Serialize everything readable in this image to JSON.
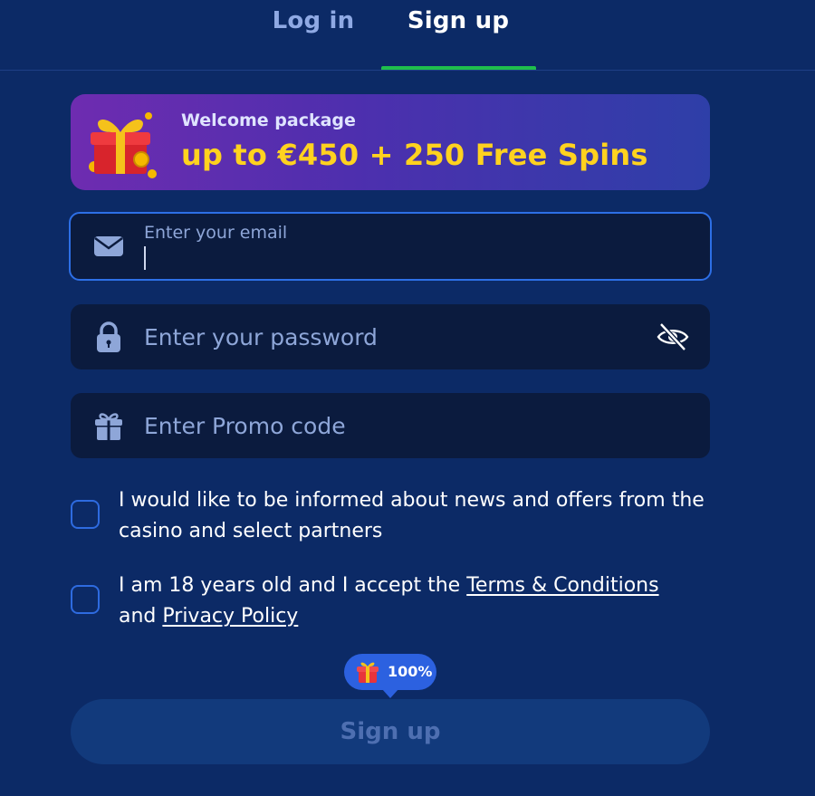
{
  "tabs": {
    "login": "Log in",
    "signup": "Sign up"
  },
  "banner": {
    "subtitle": "Welcome package",
    "offer": "up to €450 + 250 Free Spins",
    "icon": "gift-box-icon"
  },
  "email": {
    "label": "Enter your email",
    "value": "",
    "icon": "envelope-icon"
  },
  "password": {
    "placeholder": "Enter your password",
    "icon": "lock-icon",
    "toggle_icon": "eye-slash-icon"
  },
  "promo": {
    "placeholder": "Enter Promo code",
    "icon": "gift-icon"
  },
  "consents": {
    "news": {
      "text": "I would like to be informed about news and offers from the casino and select partners",
      "checked": false
    },
    "terms": {
      "prefix": "I am 18 years old and I accept the",
      "terms_link": "Terms & Conditions",
      "connector": "and",
      "privacy_link": "Privacy Policy",
      "checked": false
    }
  },
  "bonus_badge": {
    "value": "100%",
    "icon": "gift-icon"
  },
  "submit_label": "Sign up",
  "colors": {
    "background": "#0c2a66",
    "accent_green": "#1fbf4c",
    "accent_blue": "#2d6fe6",
    "offer_yellow": "#ffd21f"
  }
}
